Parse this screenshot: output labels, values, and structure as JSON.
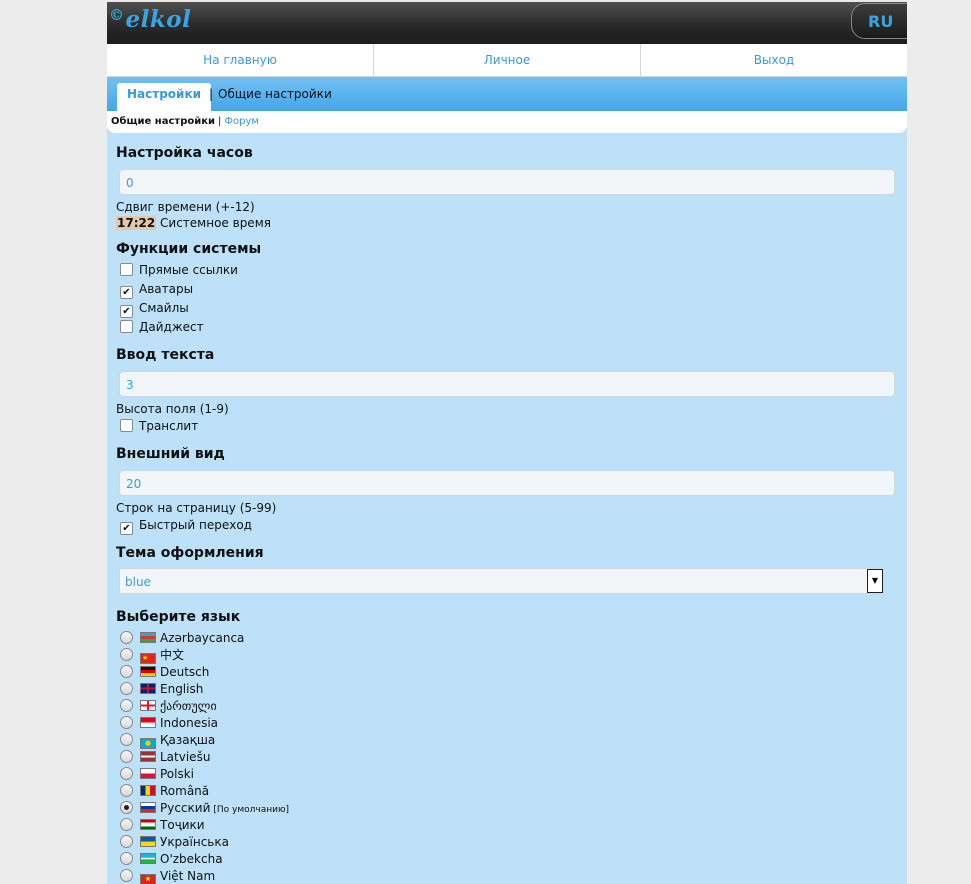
{
  "header": {
    "logo_text": "elkol",
    "logo_mark": "©",
    "lang_button": "RU"
  },
  "nav": [
    {
      "label": "На главную"
    },
    {
      "label": "Личное"
    },
    {
      "label": "Выход"
    }
  ],
  "tabs": {
    "active": "Настройки",
    "separator": "|",
    "other": "Общие настройки"
  },
  "subnav": {
    "current": "Общие настройки",
    "separator": "|",
    "link": "Форум"
  },
  "clock": {
    "heading": "Настройка часов",
    "value": "0",
    "hint": "Сдвиг времени (+-12)",
    "time": "17:22",
    "time_label": "Системное время"
  },
  "functions": {
    "heading": "Функции системы",
    "items": [
      {
        "label": "Прямые ссылки",
        "checked": false
      },
      {
        "label": "Аватары",
        "checked": true
      },
      {
        "label": "Смайлы",
        "checked": true
      },
      {
        "label": "Дайджест",
        "checked": false
      }
    ]
  },
  "text_input": {
    "heading": "Ввод текста",
    "value": "3",
    "hint": "Высота поля (1-9)",
    "translit": {
      "label": "Транслит",
      "checked": false
    }
  },
  "appearance": {
    "heading": "Внешний вид",
    "value": "20",
    "hint": "Строк на страницу (5-99)",
    "quick_jump": {
      "label": "Быстрый переход",
      "checked": true
    }
  },
  "theme": {
    "heading": "Тема оформления",
    "selected": "blue"
  },
  "language": {
    "heading": "Выберите язык",
    "default_note": "[По умолчанию]",
    "items": [
      {
        "label": "Azərbaycanca",
        "flag": "flag-az",
        "selected": false
      },
      {
        "label": "中文",
        "flag": "flag-cn",
        "selected": false
      },
      {
        "label": "Deutsch",
        "flag": "flag-de",
        "selected": false
      },
      {
        "label": "English",
        "flag": "flag-gb",
        "selected": false
      },
      {
        "label": "ქართული",
        "flag": "flag-ge",
        "selected": false
      },
      {
        "label": "Indonesia",
        "flag": "flag-id",
        "selected": false
      },
      {
        "label": "Қазақша",
        "flag": "flag-kz",
        "selected": false
      },
      {
        "label": "Latviešu",
        "flag": "flag-lv",
        "selected": false
      },
      {
        "label": "Polski",
        "flag": "flag-pl",
        "selected": false
      },
      {
        "label": "Română",
        "flag": "flag-ro",
        "selected": false
      },
      {
        "label": "Русский",
        "flag": "flag-ru",
        "selected": true
      },
      {
        "label": "Тоҷики",
        "flag": "flag-tj",
        "selected": false
      },
      {
        "label": "Українська",
        "flag": "flag-ua",
        "selected": false
      },
      {
        "label": "O'zbekcha",
        "flag": "flag-uz",
        "selected": false
      },
      {
        "label": "Việt Nam",
        "flag": "flag-vn",
        "selected": false
      }
    ]
  },
  "colors": {
    "accent": "#3a9ad9",
    "page_bg": "#bde1f8"
  }
}
